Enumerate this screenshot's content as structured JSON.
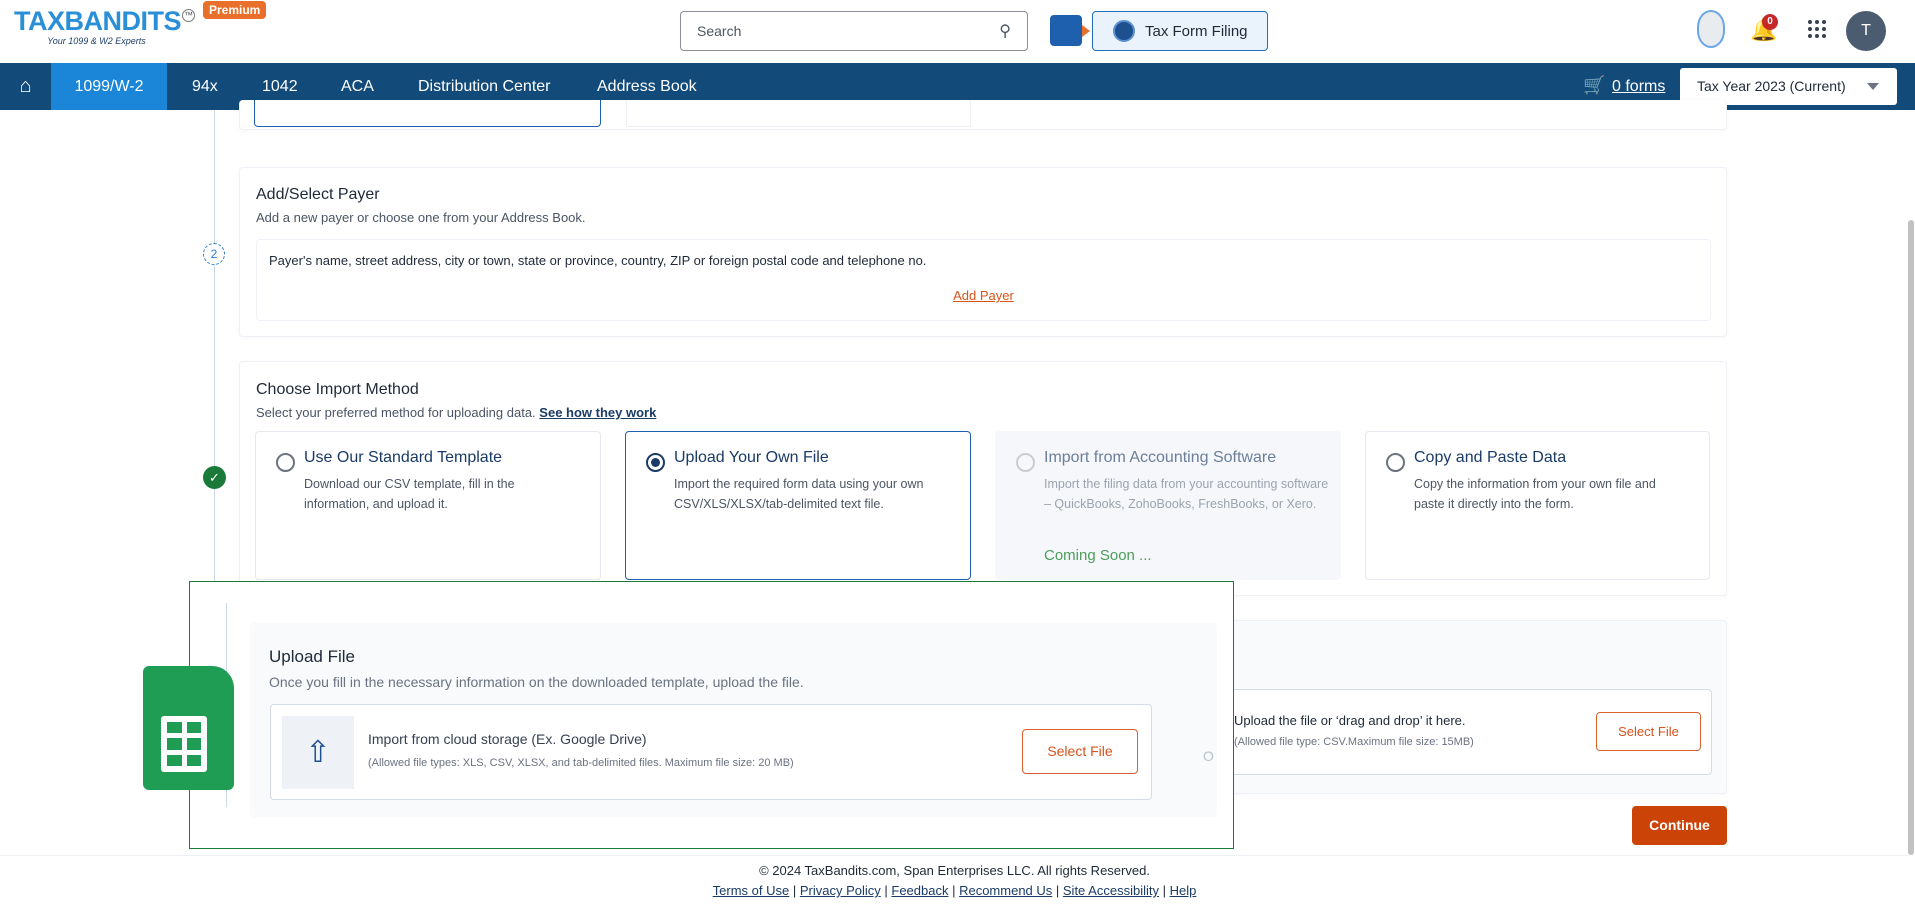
{
  "header": {
    "logo_text": "TAXBANDITS",
    "logo_tagline": "Your 1099 & W2 Experts",
    "premium_badge": "Premium",
    "search_placeholder": "Search",
    "tax_form_filing": "Tax Form Filing",
    "notification_count": "0",
    "avatar_initial": "T"
  },
  "nav": {
    "items": [
      "1099/W-2",
      "94x",
      "1042",
      "ACA",
      "Distribution Center",
      "Address Book"
    ],
    "active": "1099/W-2",
    "cart_label": "0 forms",
    "tax_year": "Tax Year 2023 (Current)"
  },
  "payer": {
    "title": "Add/Select Payer",
    "subtitle": "Add a new payer or choose one from your Address Book.",
    "step": "2",
    "fields_text": "Payer's name, street address, city or town, state or province, country, ZIP or foreign postal code and telephone no.",
    "add_link": "Add Payer"
  },
  "import": {
    "title": "Choose Import Method",
    "subtitle": "Select your preferred method for uploading data.",
    "link": "See how they work",
    "options": [
      {
        "title": "Use Our Standard Template",
        "desc": "Download our CSV template, fill in the information, and upload it.",
        "selected": false
      },
      {
        "title": "Upload Your Own File",
        "desc": "Import the required form data using your own CSV/XLS/XLSX/tab-delimited text file.",
        "selected": true
      },
      {
        "title": "Import from Accounting Software",
        "desc": "Import the filing data from your accounting software – QuickBooks, ZohoBooks, FreshBooks, or Xero.",
        "badge": "Coming Soon ...",
        "disabled": true
      },
      {
        "title": "Copy and Paste Data",
        "desc": "Copy the information from your own file and paste it directly into the form.",
        "selected": false
      }
    ]
  },
  "upload_bg": {
    "text": "Upload the file or ‘drag and drop’ it here.",
    "note": "(Allowed file type: CSV.Maximum file size: 15MB)",
    "button": "Select File",
    "or": "O"
  },
  "overlay": {
    "title": "Upload File",
    "subtitle": "Once you fill in the necessary information on the downloaded template, upload the file.",
    "cloud_title": "Import from cloud storage (Ex. Google Drive)",
    "cloud_note": "(Allowed file types: XLS, CSV, XLSX, and tab-delimited files. Maximum file size: 20 MB)",
    "button": "Select File"
  },
  "continue": "Continue",
  "footer": {
    "copyright": "© 2024 TaxBandits.com, Span Enterprises LLC. All rights Reserved.",
    "links": [
      "Terms of Use",
      "Privacy Policy",
      "Feedback",
      "Recommend Us",
      "Site Accessibility",
      "Help"
    ]
  },
  "colors": {
    "nav": "#124a7a",
    "active_tab": "#1b86d8",
    "accent": "#cc4308",
    "success": "#1b7a3a"
  }
}
